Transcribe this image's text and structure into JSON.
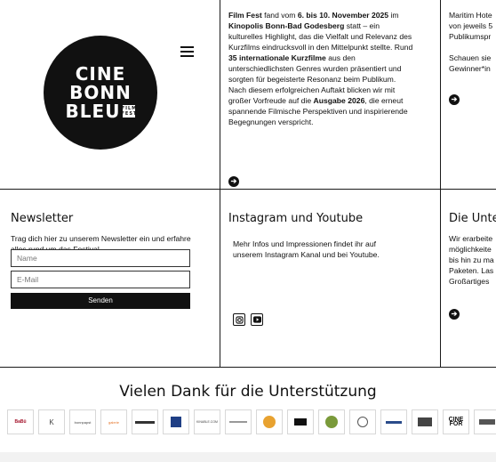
{
  "colors": {
    "accent": "#111111",
    "background": "#ffffff",
    "line": "#1a1a1a"
  },
  "logo": {
    "line1": "CINE",
    "line2": "BONN",
    "line3": "BLEU",
    "badge": "FILM FEST"
  },
  "menu": {
    "icon": "hamburger-menu-icon"
  },
  "festival": {
    "p1": "Film Fest",
    "p2": " fand vom ",
    "p3": "6. bis 10. November 2025",
    "p4": " im ",
    "p5": "Kinopolis Bonn-Bad Godesberg",
    "p6": " statt – ein kulturelles Highlight, das die Vielfalt und Relevanz des Kurzfilms eindrucksvoll in den Mittelpunkt stellte. Rund ",
    "p7": "35 internationale Kurzfilme",
    "p8": " aus den unterschiedlichsten Genres wurden präsentiert und sorgten für begeisterte Resonanz beim Publikum. Nach diesem erfolgreichen Auftakt blicken wir mit großer Vorfreude auf die ",
    "p9": "Ausgabe 2026",
    "p10": ", die erneut spannende Filmische Perspektiven und inspirierende Begegnungen verspricht."
  },
  "award": {
    "line1": "Maritim Hote",
    "line2": "von jeweils 5",
    "line3": "Publikumspr",
    "line4": "Schauen sie",
    "line5": "Gewinner*in"
  },
  "newsletter": {
    "title": "Newsletter",
    "text": "Trag dich hier zu unserem Newsletter ein und erfahre alles rund um das Festival",
    "name_placeholder": "Name",
    "email_placeholder": "E-Mail",
    "submit": "Senden"
  },
  "social": {
    "title": "Instagram und Youtube",
    "text": "Mehr Infos und Impressionen findet ihr auf unserem Instagram Kanal und bei Youtube."
  },
  "services": {
    "title": "Die Unte",
    "line1": "Wir erarbeite",
    "line2": "möglichkeite",
    "line3": "bis hin zu ma",
    "line4": "Paketen. Las",
    "line5": "Großartiges"
  },
  "thanks": "Vielen Dank für die Unterstützung",
  "sponsors": [
    {
      "label": "BaBü"
    },
    {
      "label": "K"
    },
    {
      "label": "bonnpapst"
    },
    {
      "label": "galerie"
    },
    {
      "label": ""
    },
    {
      "label": ""
    },
    {
      "label": "KINABLE.COM"
    },
    {
      "label": ""
    },
    {
      "label": ""
    },
    {
      "label": ""
    },
    {
      "label": ""
    },
    {
      "label": ""
    },
    {
      "label": ""
    },
    {
      "label": ""
    },
    {
      "label": "CINE FOR"
    },
    {
      "label": ""
    }
  ]
}
